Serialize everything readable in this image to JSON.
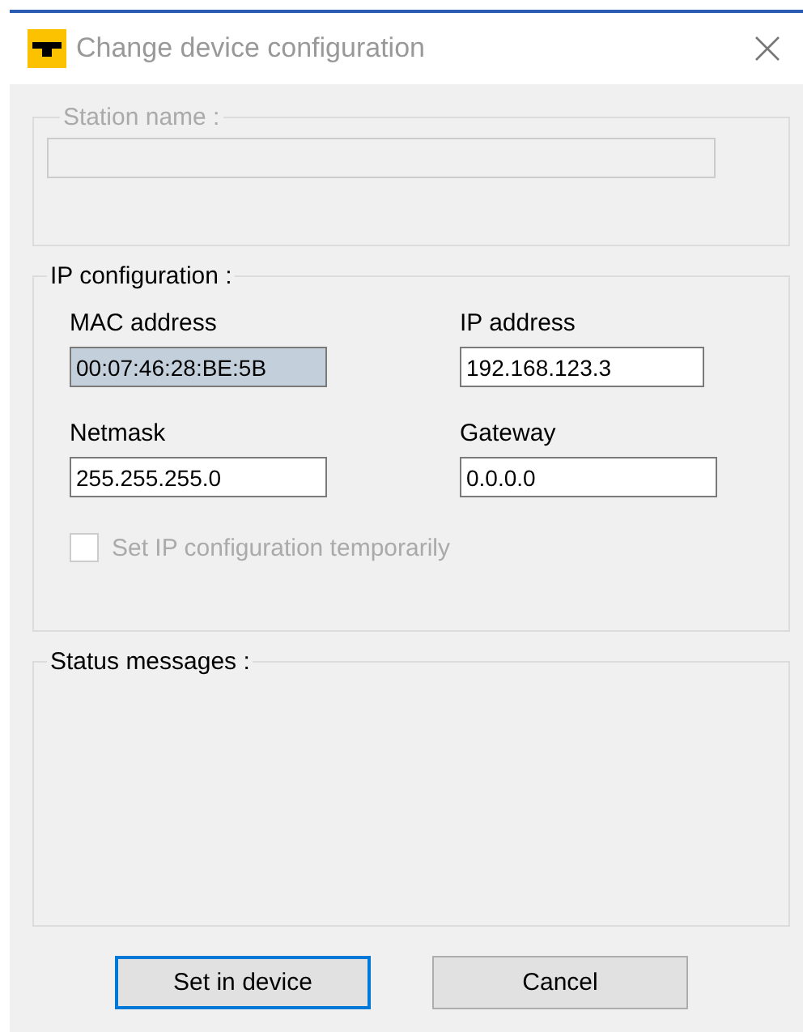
{
  "window": {
    "title": "Change device configuration",
    "active": false
  },
  "station_group": {
    "title": "Station name :",
    "disabled": true,
    "field": {
      "disabled": true
    }
  },
  "ip_group": {
    "title": "IP configuration :",
    "fields": [
      {
        "label": "MAC address",
        "value": "00:07:46:28:BE:5B",
        "highlighted": true
      },
      {
        "label": "IP address",
        "value": "192.168.123.3",
        "highlighted": false
      },
      {
        "label": "Netmask",
        "value": "255.255.255.0",
        "highlighted": false
      },
      {
        "label": "Gateway",
        "value": "0.0.0.0",
        "highlighted": false
      }
    ],
    "checkbox": {
      "label": "Set IP configuration temporarily",
      "checked": false,
      "disabled": true
    }
  },
  "status_group": {
    "title": "Status messages :"
  },
  "buttons": [
    {
      "label": "Set in device",
      "default": true
    },
    {
      "label": "Cancel",
      "default": false
    }
  ]
}
